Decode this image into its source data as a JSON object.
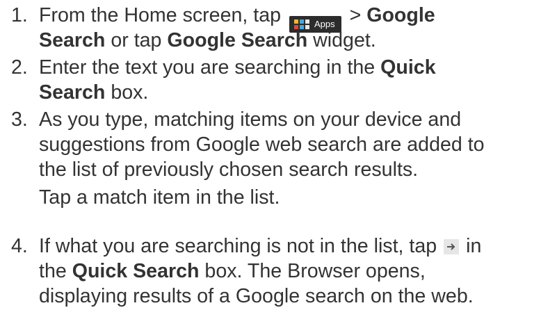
{
  "steps": [
    {
      "number": "1.",
      "line1_before_icon": "From the Home screen, tap",
      "apps_label": "Apps",
      "line1_after_icon": " > ",
      "line1_bold": "Google",
      "line2_bold1": "Search",
      "line2_mid": " or tap ",
      "line2_bold2": "Google Search",
      "line2_end": " widget."
    },
    {
      "number": "2.",
      "line1_before": "Enter the text you are searching in the ",
      "line1_bold": "Quick",
      "line2_bold": "Search",
      "line2_end": " box."
    },
    {
      "number": "3.",
      "lines": [
        "As you type, matching items on your device and",
        "suggestions from Google web search are added to",
        "the list of previously chosen search results.",
        "Tap a match item in the list."
      ]
    },
    {
      "number": "4.",
      "line1_before_icon": "If what you are searching is not in the list, tap",
      "line1_after_icon": " in",
      "line2_before": "the ",
      "line2_bold": "Quick Search",
      "line2_end": " box. The Browser opens,",
      "line3": "displaying results of a Google search on the web."
    }
  ]
}
